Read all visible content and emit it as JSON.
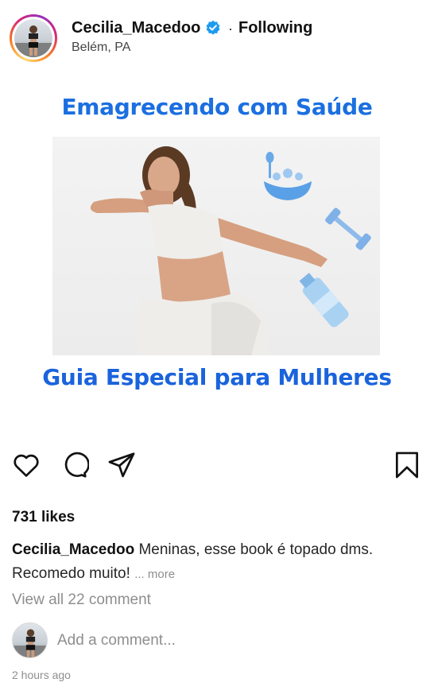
{
  "header": {
    "username": "Cecilia_Macedoo",
    "verified": true,
    "separator": "·",
    "follow_status": "Following",
    "location": "Belém, PA"
  },
  "post_image": {
    "title_top": "Emagrecendo com Saúde",
    "title_bottom": "Guia Especial para Mulheres",
    "accent_color": "#1b6fe0",
    "icons": [
      "food-bowl-icon",
      "dumbbell-icon",
      "water-bottle-icon"
    ]
  },
  "actions": {
    "icons": [
      "heart-icon",
      "comment-icon",
      "share-icon",
      "bookmark-icon"
    ]
  },
  "likes": "731 likes",
  "caption": {
    "username": "Cecilia_Macedoo",
    "text": "Meninas, esse book é topado dms. Recomedo muito!",
    "more": "... more"
  },
  "comments": {
    "view_all": "View all 22 comment",
    "placeholder": "Add a comment..."
  },
  "timestamp": "2 hours ago"
}
